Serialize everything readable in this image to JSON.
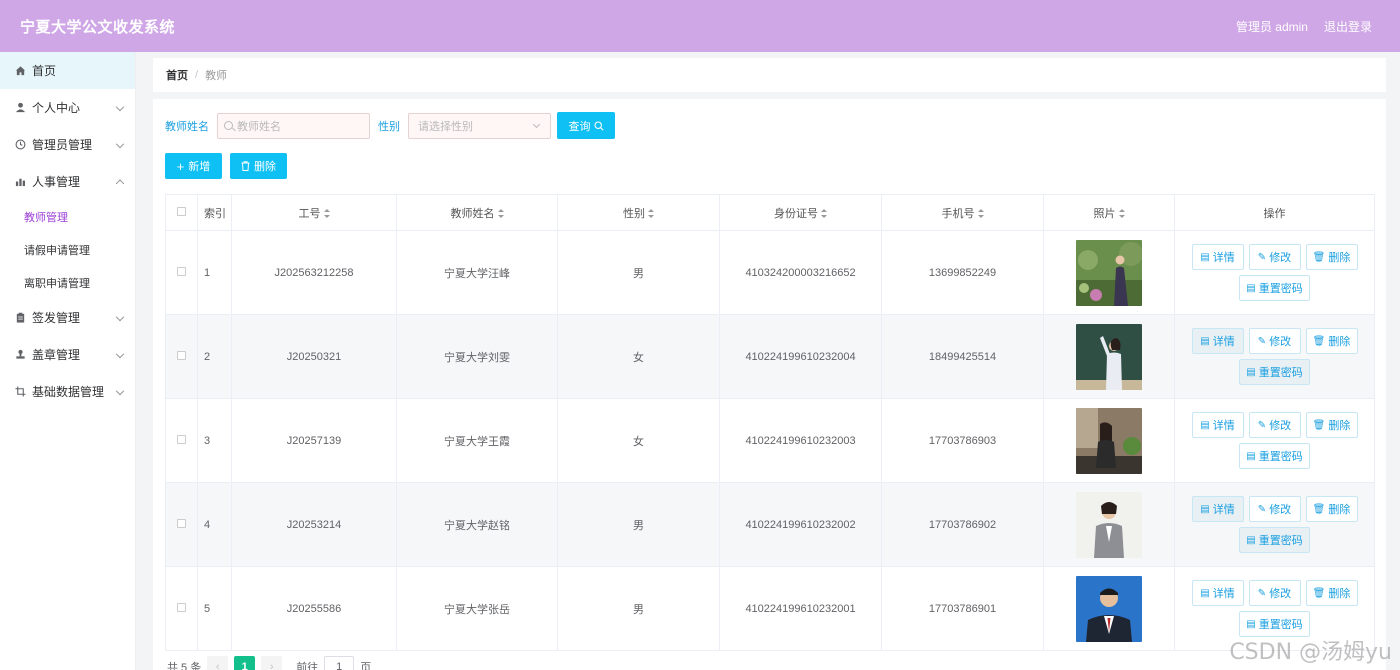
{
  "header": {
    "title": "宁夏大学公文收发系统",
    "user": "管理员 admin",
    "logout": "退出登录"
  },
  "sidebar": {
    "items": [
      {
        "label": "首页",
        "icon": "home-icon"
      },
      {
        "label": "个人中心",
        "icon": "user-icon"
      },
      {
        "label": "管理员管理",
        "icon": "clock-icon"
      },
      {
        "label": "人事管理",
        "icon": "chart-icon"
      },
      {
        "label": "签发管理",
        "icon": "clipboard-icon"
      },
      {
        "label": "盖章管理",
        "icon": "stamp-icon"
      },
      {
        "label": "基础数据管理",
        "icon": "crop-icon"
      }
    ],
    "sub_items": [
      "教师管理",
      "请假申请管理",
      "离职申请管理"
    ]
  },
  "breadcrumb": {
    "home": "首页",
    "sep": "/",
    "current": "教师"
  },
  "search": {
    "name_label": "教师姓名",
    "name_placeholder": "教师姓名",
    "gender_label": "性别",
    "gender_placeholder": "请选择性别",
    "query_label": "查询"
  },
  "actions": {
    "add": "新增",
    "delete": "删除"
  },
  "table": {
    "headers": [
      "索引",
      "工号",
      "教师姓名",
      "性别",
      "身份证号",
      "手机号",
      "照片",
      "操作"
    ],
    "rows": [
      {
        "idx": "1",
        "no": "J202563212258",
        "name": "宁夏大学汪峰",
        "gender": "男",
        "id": "410324200003216652",
        "phone": "13699852249"
      },
      {
        "idx": "2",
        "no": "J20250321",
        "name": "宁夏大学刘雯",
        "gender": "女",
        "id": "410224199610232004",
        "phone": "18499425514"
      },
      {
        "idx": "3",
        "no": "J20257139",
        "name": "宁夏大学王霞",
        "gender": "女",
        "id": "410224199610232003",
        "phone": "17703786903"
      },
      {
        "idx": "4",
        "no": "J20253214",
        "name": "宁夏大学赵铭",
        "gender": "男",
        "id": "410224199610232002",
        "phone": "17703786902"
      },
      {
        "idx": "5",
        "no": "J20255586",
        "name": "宁夏大学张岳",
        "gender": "男",
        "id": "410224199610232001",
        "phone": "17703786901"
      }
    ],
    "ops": {
      "detail": "详情",
      "edit": "修改",
      "delete": "删除",
      "reset": "重置密码"
    }
  },
  "pager": {
    "total": "共 5 条",
    "current": "1",
    "goto": "前往",
    "page_value": "1",
    "page_unit": "页"
  },
  "watermark": "CSDN @汤姆yu"
}
